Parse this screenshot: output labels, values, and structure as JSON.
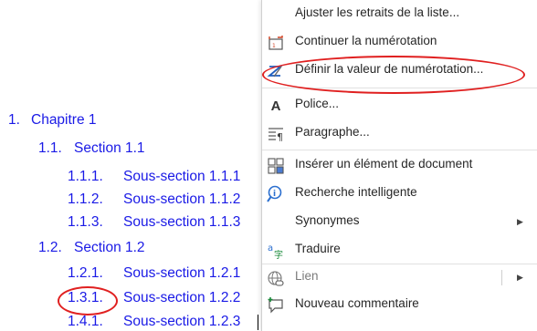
{
  "document": {
    "lines": [
      {
        "num": "1.",
        "text": "Chapitre 1"
      },
      {
        "num": "1.1.",
        "text": "Section 1.1"
      },
      {
        "num": "1.1.1.",
        "text": "Sous-section 1.1.1"
      },
      {
        "num": "1.1.2.",
        "text": "Sous-section 1.1.2"
      },
      {
        "num": "1.1.3.",
        "text": "Sous-section 1.1.3"
      },
      {
        "num": "1.2.",
        "text": "Section 1.2"
      },
      {
        "num": "1.2.1.",
        "text": "Sous-section 1.2.1"
      },
      {
        "num": "1.3.1.",
        "text": "Sous-section 1.2.2"
      },
      {
        "num": "1.4.1.",
        "text": "Sous-section 1.2.3"
      }
    ],
    "text_color": "#1a1ae6"
  },
  "context_menu": {
    "items": [
      {
        "label": "Ajuster les retraits de la liste...",
        "icon": "none"
      },
      {
        "label": "Continuer la numérotation",
        "icon": "continue-numbering-icon"
      },
      {
        "label": "Définir la valeur de numérotation...",
        "icon": "set-numbering-value-icon"
      },
      {
        "label": "Police...",
        "icon": "font-icon"
      },
      {
        "label": "Paragraphe...",
        "icon": "paragraph-icon"
      },
      {
        "label": "Insérer un élément de document",
        "icon": "quick-parts-icon"
      },
      {
        "label": "Recherche intelligente",
        "icon": "smart-lookup-icon"
      },
      {
        "label": "Synonymes",
        "icon": "none",
        "submenu": true
      },
      {
        "label": "Traduire",
        "icon": "translate-icon"
      },
      {
        "label": "Lien",
        "icon": "link-icon",
        "submenu": true,
        "disabled": true
      },
      {
        "label": "Nouveau commentaire",
        "icon": "comment-icon"
      }
    ]
  },
  "annotation_color": "#e02020"
}
